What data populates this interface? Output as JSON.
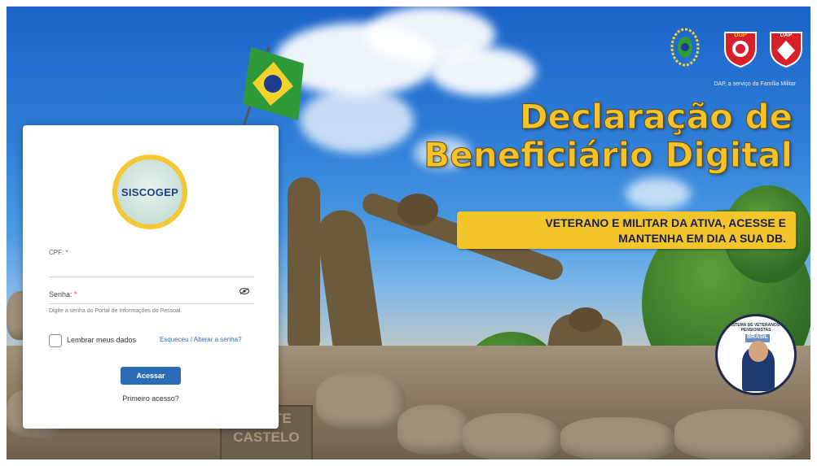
{
  "login": {
    "logo_text": "SISCOGEP",
    "cpf_label": "CPF:",
    "required_mark": "*",
    "password_label": "Senha:",
    "password_hint": "Digite a senha do Portal de Informações do Pessoal.",
    "remember_label": "Lembrar meus dados",
    "forgot_link": "Esqueceu / Alterar a senha?",
    "submit_label": "Acessar",
    "first_access_link": "Primeiro acesso?"
  },
  "hero": {
    "title_line1": "Declaração de",
    "title_line2": "Beneficiário Digital",
    "banner_line1": "VETERANO E MILITAR DA ATIVA, ACESSE E",
    "banner_line2": "MANTENHA EM DIA A SUA DB.",
    "caption": "DAP, a serviço da Família Militar",
    "badge_dgp": "DGP",
    "badge_dap": "DAP",
    "plaque_line1": "MONTE",
    "plaque_line2": "CASTELO",
    "seal_text": "SISTEMA DE VETERANOS E PENSIONISTAS",
    "seal_brasil": "BRASIL"
  },
  "colors": {
    "primary_button": "#2b6cb7",
    "title_yellow": "#f5c22b",
    "banner_yellow": "#f2c52a",
    "banner_text": "#1d1f4f",
    "logo_ring": "#f3c832",
    "logo_text": "#1c3f8c"
  },
  "icons": [
    "show-password-eye-icon",
    "army-emblem-icon",
    "dgp-shield-icon",
    "dap-shield-icon",
    "brazil-flag-icon"
  ]
}
